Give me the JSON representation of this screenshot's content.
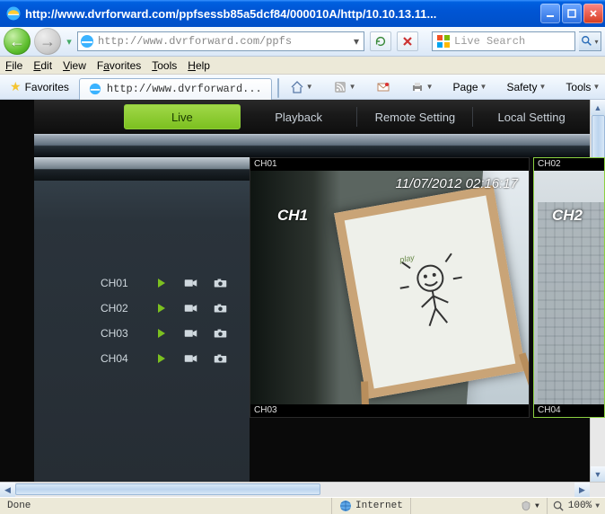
{
  "window": {
    "title": "http://www.dvrforward.com/ppfsessb85a5dcf84/000010A/http/10.10.13.11...",
    "min": "_",
    "max": "▢",
    "close": "✕"
  },
  "nav": {
    "url_display": "http://www.dvrforward.com/ppfs",
    "refresh_tip": "Refresh",
    "stop_tip": "Stop",
    "search_placeholder": "Live Search"
  },
  "menu": {
    "file": "File",
    "edit": "Edit",
    "view": "View",
    "favorites": "Favorites",
    "tools": "Tools",
    "help": "Help"
  },
  "favrow": {
    "favorites": "Favorites",
    "tab_title": "http://www.dvrforward...",
    "cmd_page": "Page",
    "cmd_safety": "Safety",
    "cmd_tools": "Tools"
  },
  "dvr": {
    "tabs": {
      "live": "Live",
      "playback": "Playback",
      "remote": "Remote Setting",
      "local": "Local Setting"
    },
    "channels": [
      {
        "name": "CH01"
      },
      {
        "name": "CH02"
      },
      {
        "name": "CH03"
      },
      {
        "name": "CH04"
      }
    ],
    "grid": {
      "ch01_top": "CH01",
      "ch02_top": "CH02",
      "ch03_bot": "CH03",
      "ch04_bot": "CH04",
      "ch1_timestamp": "11/07/2012 02:16:17",
      "ch1_osd": "CH1",
      "ch2_osd": "CH2"
    }
  },
  "status": {
    "done": "Done",
    "zone": "Internet",
    "zoom": "100%"
  }
}
